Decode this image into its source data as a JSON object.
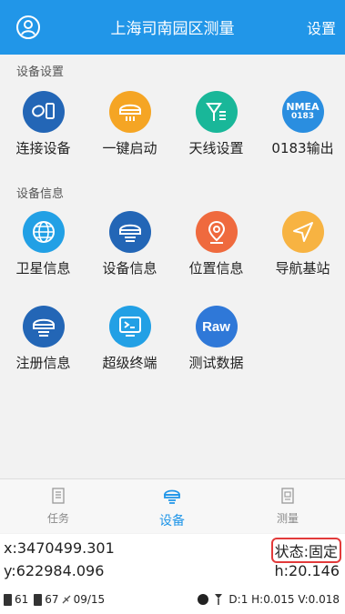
{
  "header": {
    "title": "上海司南园区测量",
    "settings_label": "设置"
  },
  "sections": {
    "device_settings": "设备设置",
    "device_info": "设备信息"
  },
  "tiles": {
    "connect": "连接设备",
    "oneclick": "一键启动",
    "antenna": "天线设置",
    "nmea": "0183输出",
    "satellite": "卫星信息",
    "deviceinfo": "设备信息",
    "position": "位置信息",
    "navbase": "导航基站",
    "register": "注册信息",
    "terminal": "超级终端",
    "testdata": "测试数据"
  },
  "tile_icon_text": {
    "nmea_top": "NMEA",
    "nmea_bottom": "0183",
    "raw": "Raw"
  },
  "tabs": {
    "task": "任务",
    "device": "设备",
    "measure": "测量"
  },
  "status": {
    "x": "x:3470499.301",
    "y": "y:622984.096",
    "state": "状态:固定",
    "h": "h:20.146",
    "sat_a": "61",
    "sat_b": "67",
    "sat_c": "09/15",
    "precision": "D:1 H:0.015 V:0.018"
  },
  "colors": {
    "accent": "#2196e8",
    "state_border": "#e23a3a"
  }
}
